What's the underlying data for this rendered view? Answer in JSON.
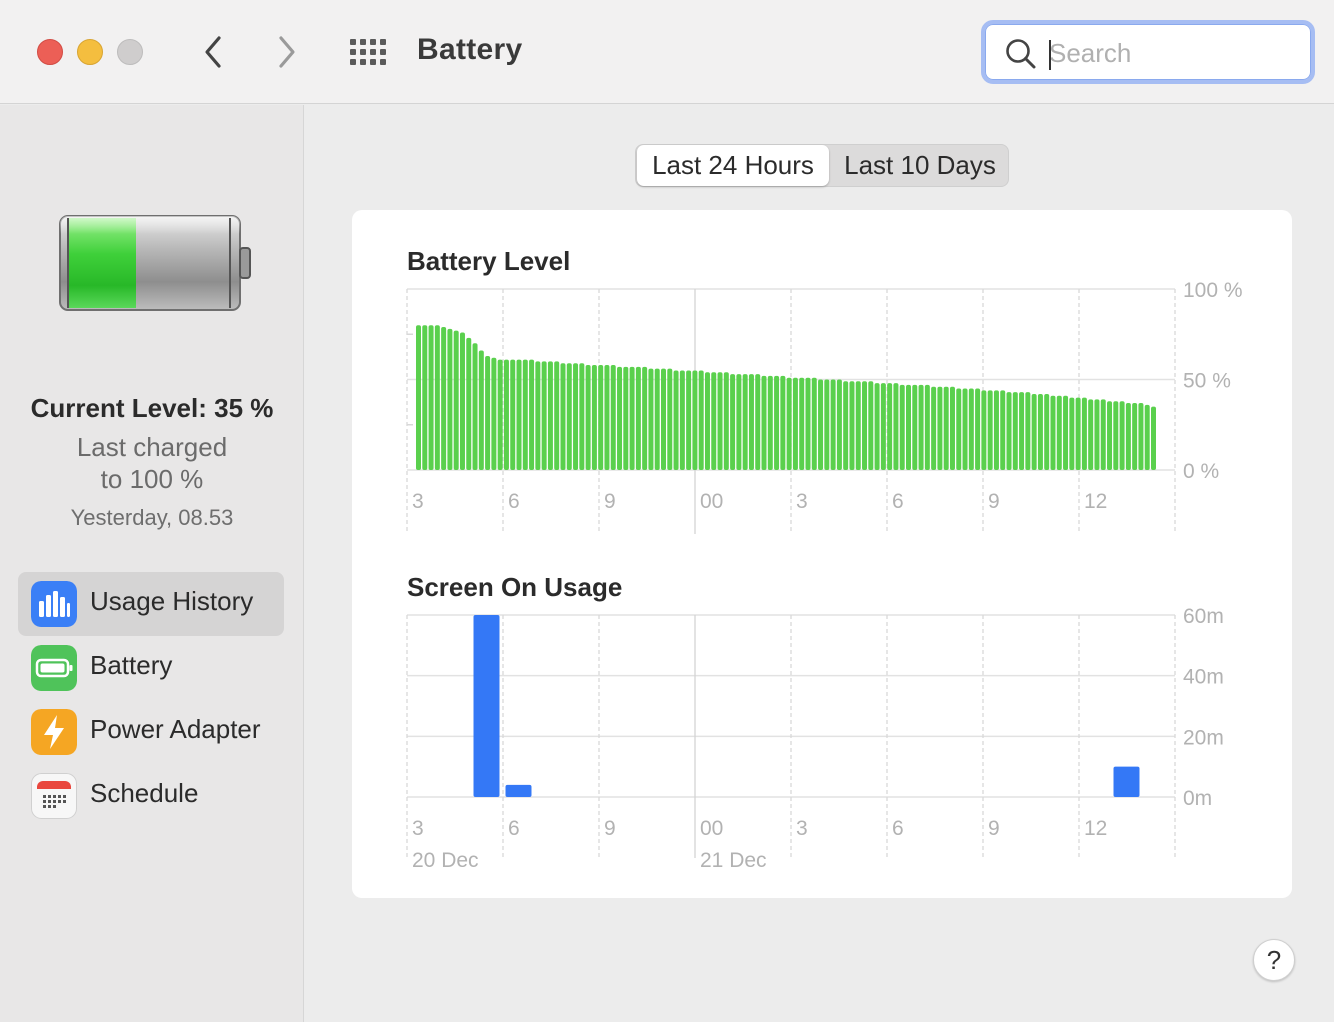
{
  "window": {
    "title": "Battery",
    "search": {
      "placeholder": "Search",
      "value": ""
    }
  },
  "sidebar": {
    "current_level": "Current Level: 35 %",
    "last_charged_line1": "Last charged",
    "last_charged_line2": "to 100 %",
    "last_charged_time": "Yesterday, 08.53",
    "items": [
      {
        "label": "Usage History",
        "icon": "usage-history-icon",
        "color": "#3a7ff6",
        "active": true
      },
      {
        "label": "Battery",
        "icon": "battery-icon",
        "color": "#4fc35a",
        "active": false
      },
      {
        "label": "Power Adapter",
        "icon": "power-adapter-icon",
        "color": "#f5a623",
        "active": false
      },
      {
        "label": "Schedule",
        "icon": "calendar-icon",
        "color": "#e9473e",
        "active": false
      }
    ]
  },
  "main": {
    "tabs": [
      {
        "label": "Last 24 Hours",
        "selected": true
      },
      {
        "label": "Last 10 Days",
        "selected": false
      }
    ],
    "help_label": "?"
  },
  "chart_data": [
    {
      "type": "bar",
      "title": "Battery Level",
      "color": "#5ad04d",
      "y_ticks": [
        "100 %",
        "50 %",
        "0 %"
      ],
      "ylim": [
        0,
        100
      ],
      "x_ticks": [
        "3",
        "6",
        "9",
        "00",
        "3",
        "6",
        "9",
        "12"
      ],
      "values": [
        80,
        80,
        80,
        80,
        79,
        78,
        77,
        76,
        73,
        70,
        66,
        63,
        62,
        61,
        61,
        61,
        61,
        61,
        61,
        60,
        60,
        60,
        60,
        59,
        59,
        59,
        59,
        58,
        58,
        58,
        58,
        58,
        57,
        57,
        57,
        57,
        57,
        56,
        56,
        56,
        56,
        55,
        55,
        55,
        55,
        55,
        54,
        54,
        54,
        54,
        53,
        53,
        53,
        53,
        53,
        52,
        52,
        52,
        52,
        51,
        51,
        51,
        51,
        51,
        50,
        50,
        50,
        50,
        49,
        49,
        49,
        49,
        49,
        48,
        48,
        48,
        48,
        47,
        47,
        47,
        47,
        47,
        46,
        46,
        46,
        46,
        45,
        45,
        45,
        45,
        44,
        44,
        44,
        44,
        43,
        43,
        43,
        43,
        42,
        42,
        42,
        41,
        41,
        41,
        40,
        40,
        40,
        39,
        39,
        39,
        38,
        38,
        38,
        37,
        37,
        37,
        36,
        35
      ]
    },
    {
      "type": "bar",
      "title": "Screen On Usage",
      "color": "#3478f6",
      "y_ticks": [
        "60m",
        "40m",
        "20m",
        "0m"
      ],
      "ylim": [
        0,
        60
      ],
      "x_ticks": [
        "3",
        "6",
        "9",
        "00",
        "3",
        "6",
        "9",
        "12"
      ],
      "date_labels": [
        "20 Dec",
        "21 Dec"
      ],
      "values": [
        0,
        0,
        60,
        4,
        0,
        0,
        0,
        0,
        0,
        0,
        0,
        0,
        0,
        0,
        0,
        0,
        0,
        0,
        0,
        0,
        0,
        0,
        10
      ]
    }
  ]
}
